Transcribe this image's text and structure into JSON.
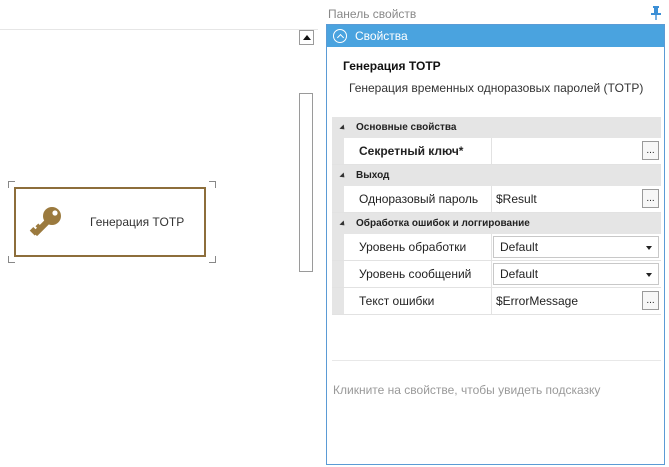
{
  "canvas": {
    "activity_label": "Генерация TOTP"
  },
  "panel": {
    "window_title": "Панель свойств",
    "header_label": "Свойства",
    "activity_name": "Генерация TOTP",
    "activity_description": "Генерация временных одноразовых паролей (TOTP)",
    "hint": "Кликните на свойстве, чтобы увидеть подсказку",
    "ellipsis": "...",
    "categories": [
      {
        "label": "Основные свойства",
        "rows": [
          {
            "name": "Секретный ключ*",
            "value": ""
          }
        ]
      },
      {
        "label": "Выход",
        "rows": [
          {
            "name": "Одноразовый пароль",
            "value": "$Result"
          }
        ]
      },
      {
        "label": "Обработка ошибок и логгирование",
        "rows": [
          {
            "name": "Уровень обработки",
            "value": "Default"
          },
          {
            "name": "Уровень сообщений",
            "value": "Default"
          },
          {
            "name": "Текст ошибки",
            "value": "$ErrorMessage"
          }
        ]
      }
    ]
  },
  "colors": {
    "accent": "#4aa3df",
    "activity_border": "#8d6e3b",
    "key_icon": "#9b7a3e"
  },
  "icons": {
    "activity": "key-icon",
    "pin": "pin-icon",
    "collapse": "chevron-up-icon"
  }
}
